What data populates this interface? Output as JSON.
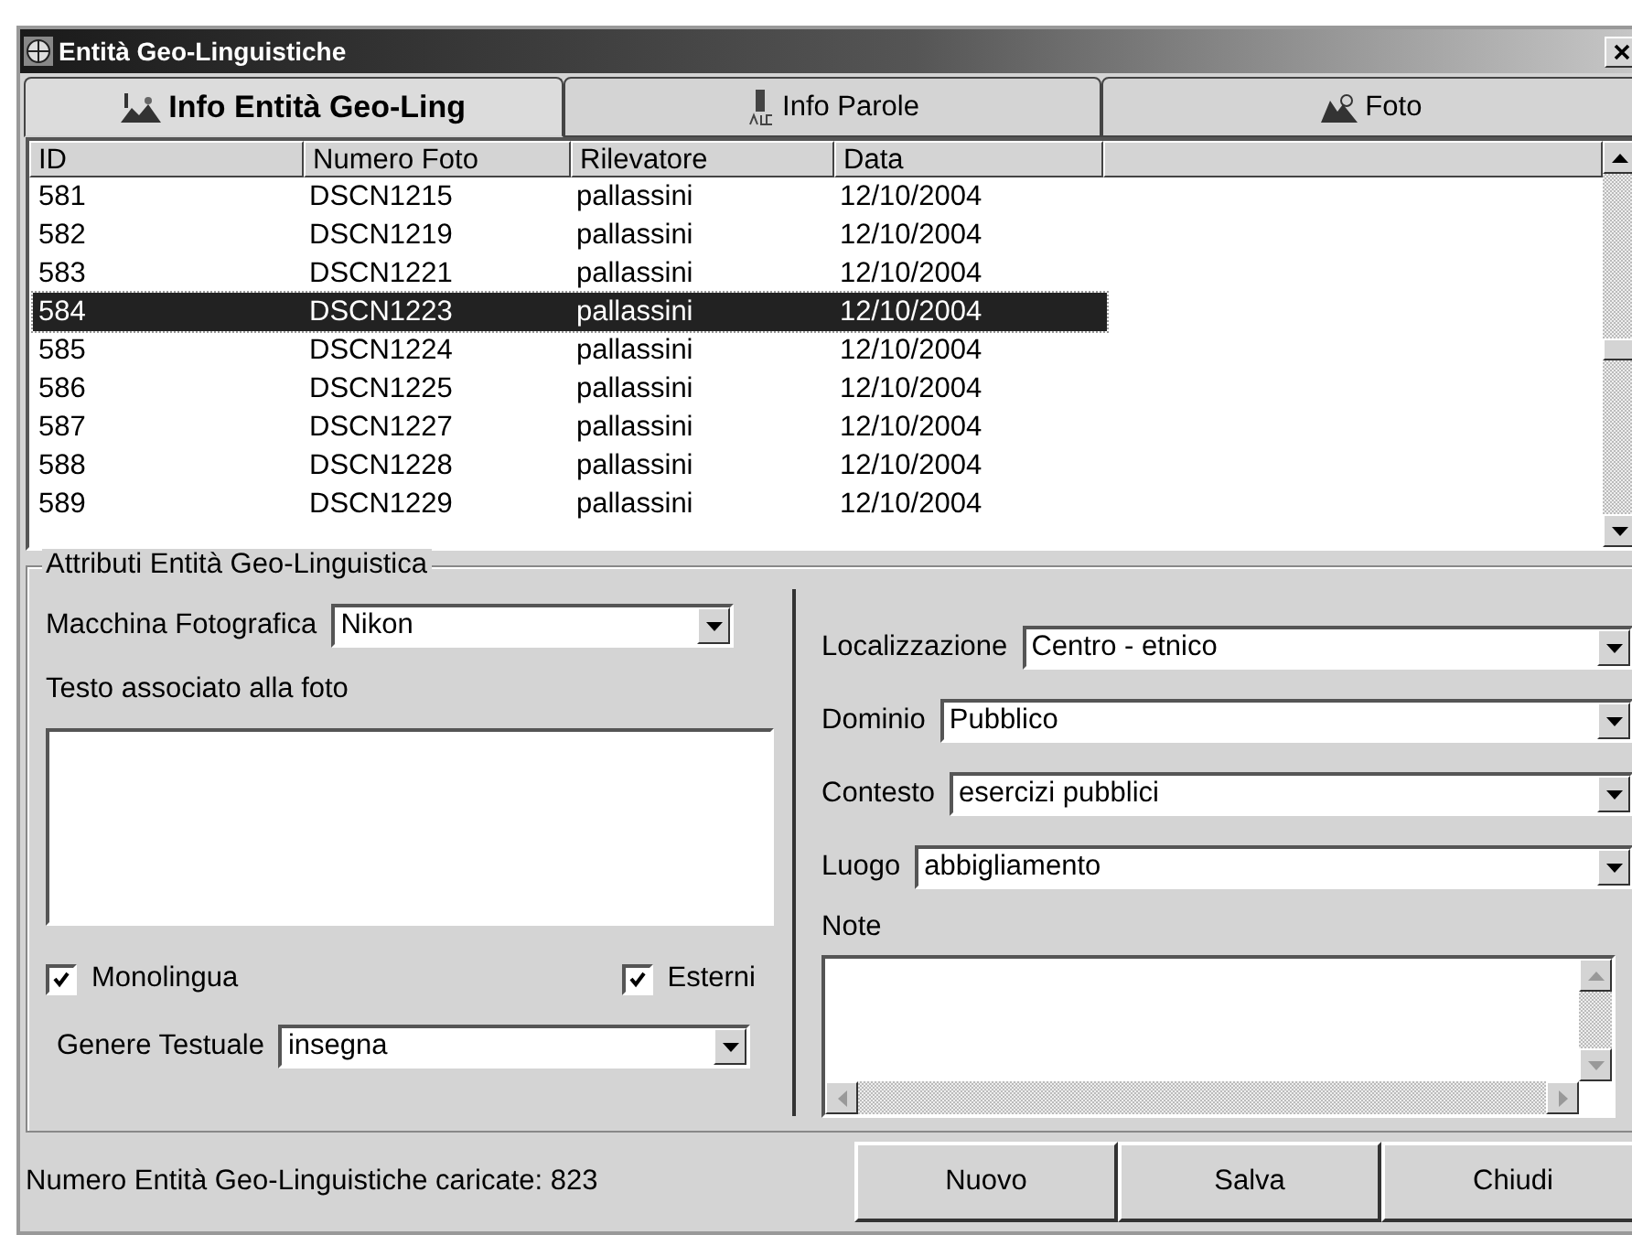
{
  "window": {
    "title": "Entità Geo-Linguistiche"
  },
  "tabs": [
    {
      "label": "Info Entità Geo-Ling",
      "selected": true
    },
    {
      "label": "Info Parole",
      "selected": false
    },
    {
      "label": "Foto",
      "selected": false
    }
  ],
  "table": {
    "columns": [
      "ID",
      "Numero Foto",
      "Rilevatore",
      "Data"
    ],
    "rows": [
      {
        "cells": [
          "581",
          "DSCN1215",
          "pallassini",
          "12/10/2004"
        ],
        "selected": false
      },
      {
        "cells": [
          "582",
          "DSCN1219",
          "pallassini",
          "12/10/2004"
        ],
        "selected": false
      },
      {
        "cells": [
          "583",
          "DSCN1221",
          "pallassini",
          "12/10/2004"
        ],
        "selected": false
      },
      {
        "cells": [
          "584",
          "DSCN1223",
          "pallassini",
          "12/10/2004"
        ],
        "selected": true
      },
      {
        "cells": [
          "585",
          "DSCN1224",
          "pallassini",
          "12/10/2004"
        ],
        "selected": false
      },
      {
        "cells": [
          "586",
          "DSCN1225",
          "pallassini",
          "12/10/2004"
        ],
        "selected": false
      },
      {
        "cells": [
          "587",
          "DSCN1227",
          "pallassini",
          "12/10/2004"
        ],
        "selected": false
      },
      {
        "cells": [
          "588",
          "DSCN1228",
          "pallassini",
          "12/10/2004"
        ],
        "selected": false
      },
      {
        "cells": [
          "589",
          "DSCN1229",
          "pallassini",
          "12/10/2004"
        ],
        "selected": false
      }
    ]
  },
  "attributes": {
    "title": "Attributi Entità Geo-Linguistica",
    "camera": {
      "label": "Macchina Fotografica",
      "value": "Nikon"
    },
    "text_label": "Testo associato alla foto",
    "checkboxes": [
      {
        "label": "Monolingua",
        "checked": true
      },
      {
        "label": "Esterni",
        "checked": true
      }
    ],
    "genre": {
      "label": "Genere Testuale",
      "value": "insegna"
    },
    "right_fields": [
      {
        "label": "Localizzazione",
        "value": "Centro - etnico"
      },
      {
        "label": "Dominio",
        "value": "Pubblico"
      },
      {
        "label": "Contesto",
        "value": "esercizi pubblici"
      },
      {
        "label": "Luogo",
        "value": "abbigliamento"
      }
    ],
    "note_label": "Note"
  },
  "status": "Numero Entità Geo-Linguistiche caricate: 823",
  "buttons": [
    "Nuovo",
    "Salva",
    "Chiudi"
  ]
}
